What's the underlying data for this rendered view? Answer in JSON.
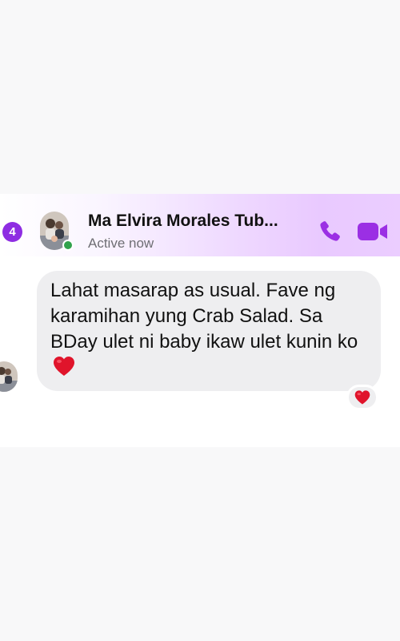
{
  "header": {
    "back_badge_count": "4",
    "contact_name": "Ma Elvira Morales Tub...",
    "status": "Active now",
    "call_icon": "phone-icon",
    "video_icon": "video-camera-icon"
  },
  "message": {
    "text": "Lahat masarap as usual. Fave ng karamihan yung Crab Salad. Sa BDay ulet ni baby ikaw ulet kunin ko",
    "inline_emoji": "heart-icon",
    "reaction_emoji": "heart-icon"
  },
  "colors": {
    "accent": "#8e2de2",
    "online": "#31a24c",
    "bubble": "#eeeef0",
    "heart": "#e0142b"
  }
}
